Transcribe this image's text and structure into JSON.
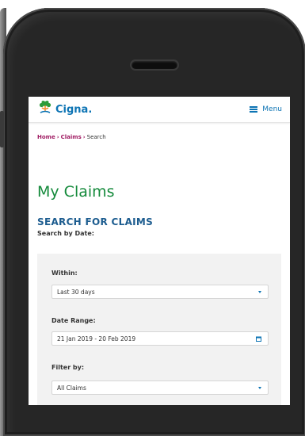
{
  "header": {
    "logo_text": "Cigna.",
    "menu_label": "Menu"
  },
  "breadcrumb": {
    "items": [
      "Home",
      "Claims",
      "Search"
    ]
  },
  "page": {
    "title": "My Claims",
    "section_title": "SEARCH FOR CLAIMS",
    "subtitle": "Search by Date:"
  },
  "form": {
    "within_label": "Within:",
    "within_value": "Last 30 days",
    "date_range_label": "Date Range:",
    "date_range_value": "21 Jan 2019 - 20 Feb 2019",
    "filter_label": "Filter by:",
    "filter_value": "All Claims"
  },
  "colors": {
    "brand_blue": "#0d74b4",
    "title_green": "#148a3b",
    "breadcrumb_link": "#a01c63",
    "section_blue": "#1c5c8f"
  }
}
